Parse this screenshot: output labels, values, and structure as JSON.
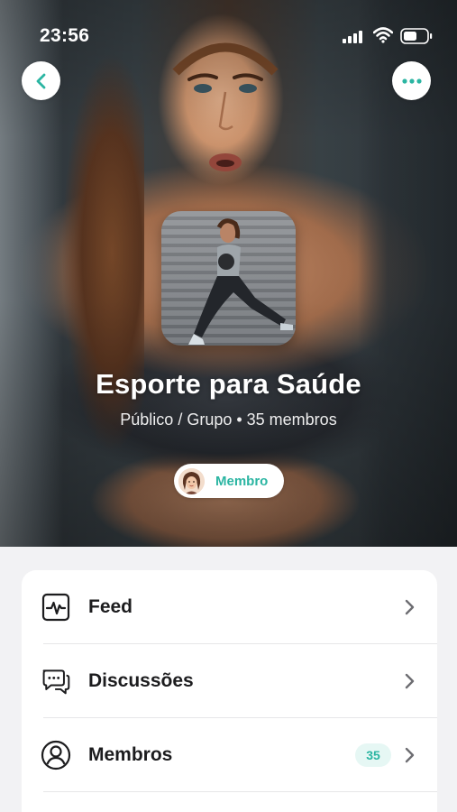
{
  "status_bar": {
    "time": "23:56"
  },
  "group": {
    "name": "Esporte para Saúde",
    "subtitle": "Público / Grupo • 35 membros",
    "membership_label": "Membro"
  },
  "menu": [
    {
      "label": "Feed",
      "icon": "activity-pulse-icon"
    },
    {
      "label": "Discussões",
      "icon": "chat-bubbles-icon"
    },
    {
      "label": "Membros",
      "icon": "user-icon",
      "count": "35"
    }
  ],
  "colors": {
    "accent": "#2bb5a2",
    "accent_bg": "#e6f7f4",
    "page_bg": "#f2f2f4",
    "text": "#1c1c1e"
  }
}
